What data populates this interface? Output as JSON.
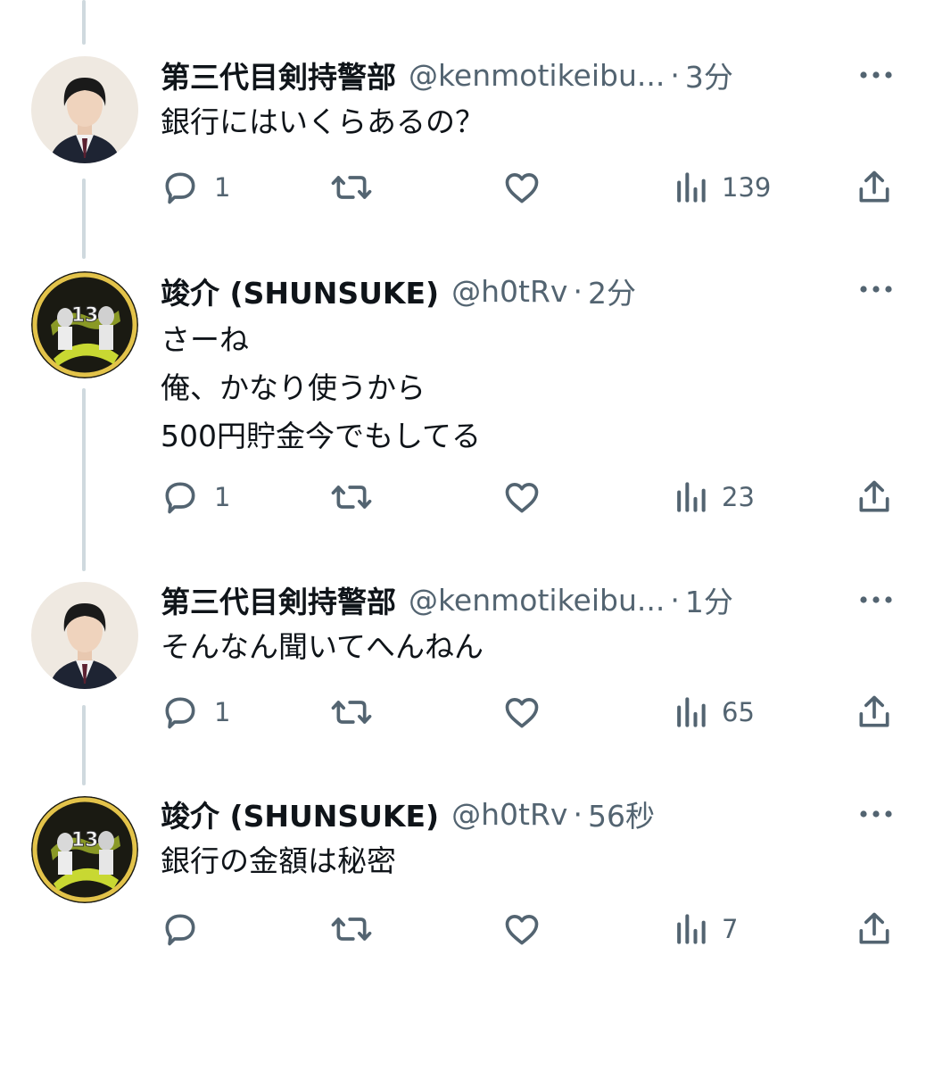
{
  "tweets": [
    {
      "name": "第三代目剣持警部",
      "handle": "@kenmotikeibu...",
      "dot": "·",
      "time": "3分",
      "lines": [
        "銀行にはいくらあるの？"
      ],
      "reply_count": "1",
      "views": "139",
      "avatar": "portrait-boy-suit"
    },
    {
      "name": "竣介 (SHUNSUKE)",
      "handle": "@h0tRv",
      "dot": "·",
      "time": "2分",
      "lines": [
        "さーね",
        "俺、かなり使うから",
        "500円貯金今でもしてる"
      ],
      "reply_count": "1",
      "views": "23",
      "avatar": "baseball-gold-badge"
    },
    {
      "name": "第三代目剣持警部",
      "handle": "@kenmotikeibu...",
      "dot": "·",
      "time": "1分",
      "lines": [
        "そんなん聞いてへんねん"
      ],
      "reply_count": "1",
      "views": "65",
      "avatar": "portrait-boy-suit"
    },
    {
      "name": "竣介 (SHUNSUKE)",
      "handle": "@h0tRv",
      "dot": "·",
      "time": "56秒",
      "lines": [
        "銀行の金額は秘密"
      ],
      "reply_count": "",
      "views": "7",
      "avatar": "baseball-gold-badge"
    }
  ],
  "colors": {
    "text": "#0f1419",
    "secondary": "#536471",
    "thread_line": "#cfd9de"
  }
}
